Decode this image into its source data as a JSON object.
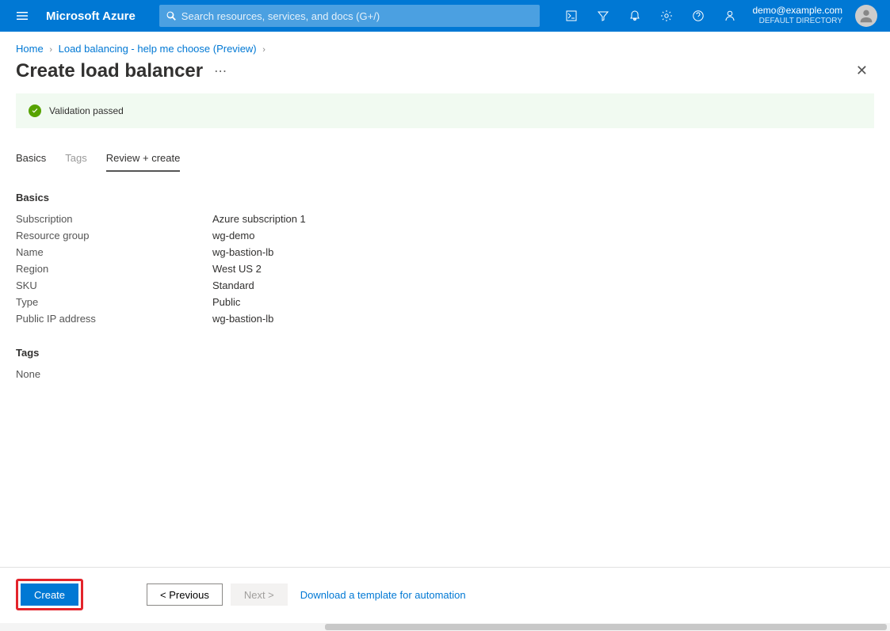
{
  "header": {
    "brand": "Microsoft Azure",
    "search_placeholder": "Search resources, services, and docs (G+/)",
    "account_email": "demo@example.com",
    "account_directory": "DEFAULT DIRECTORY"
  },
  "breadcrumbs": [
    {
      "label": "Home"
    },
    {
      "label": "Load balancing - help me choose (Preview)"
    }
  ],
  "page": {
    "title": "Create load balancer"
  },
  "validation": {
    "message": "Validation passed"
  },
  "tabs": {
    "basics": "Basics",
    "tags": "Tags",
    "review": "Review + create"
  },
  "summary": {
    "basics_header": "Basics",
    "rows": [
      {
        "k": "Subscription",
        "v": "Azure subscription 1"
      },
      {
        "k": "Resource group",
        "v": "wg-demo"
      },
      {
        "k": "Name",
        "v": "wg-bastion-lb"
      },
      {
        "k": "Region",
        "v": "West US 2"
      },
      {
        "k": "SKU",
        "v": "Standard"
      },
      {
        "k": "Type",
        "v": "Public"
      },
      {
        "k": "Public IP address",
        "v": "wg-bastion-lb"
      }
    ],
    "tags_header": "Tags",
    "tags_none": "None"
  },
  "footer": {
    "create": "Create",
    "previous": "< Previous",
    "next": "Next >",
    "download_link": "Download a template for automation"
  }
}
